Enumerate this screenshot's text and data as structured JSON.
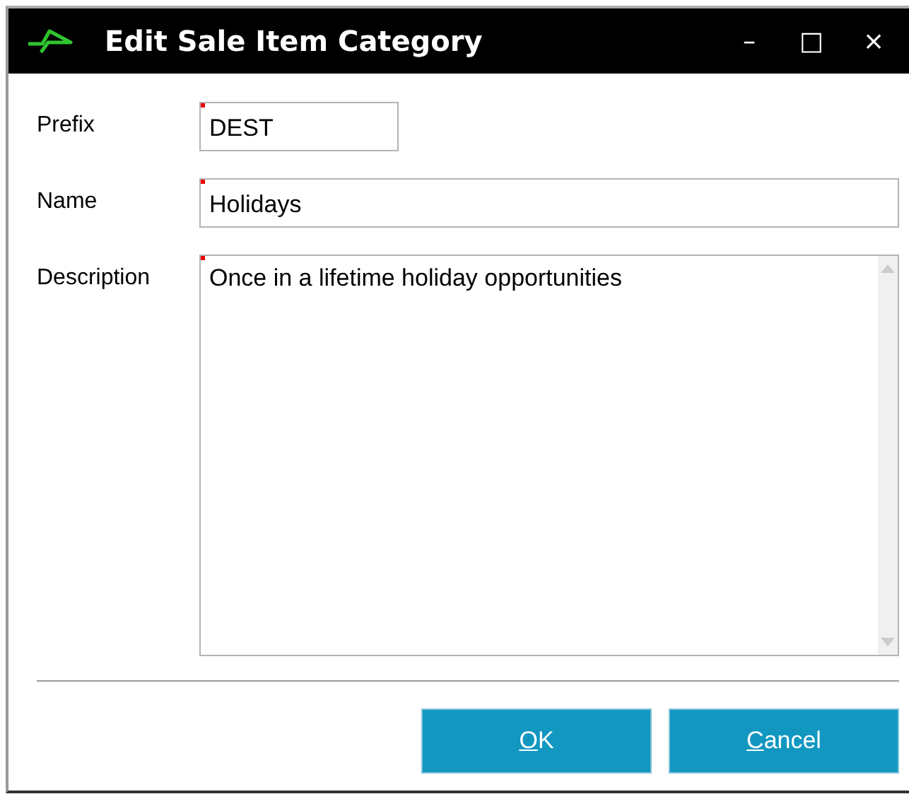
{
  "window": {
    "title": "Edit Sale Item Category",
    "controls": [
      "–",
      "□",
      "×"
    ]
  },
  "fields": [
    {
      "kind": "short",
      "label": "Prefix",
      "value": "DEST",
      "required": true
    },
    {
      "kind": "line",
      "label": "Name",
      "value": "Holidays",
      "required": true
    },
    {
      "kind": "multiline",
      "label": "Description",
      "value": "Once in a lifetime holiday opportunities",
      "required": true
    }
  ],
  "buttons": [
    {
      "label": "OK",
      "underline_first": true
    },
    {
      "label": "Cancel",
      "underline_first": true
    }
  ]
}
